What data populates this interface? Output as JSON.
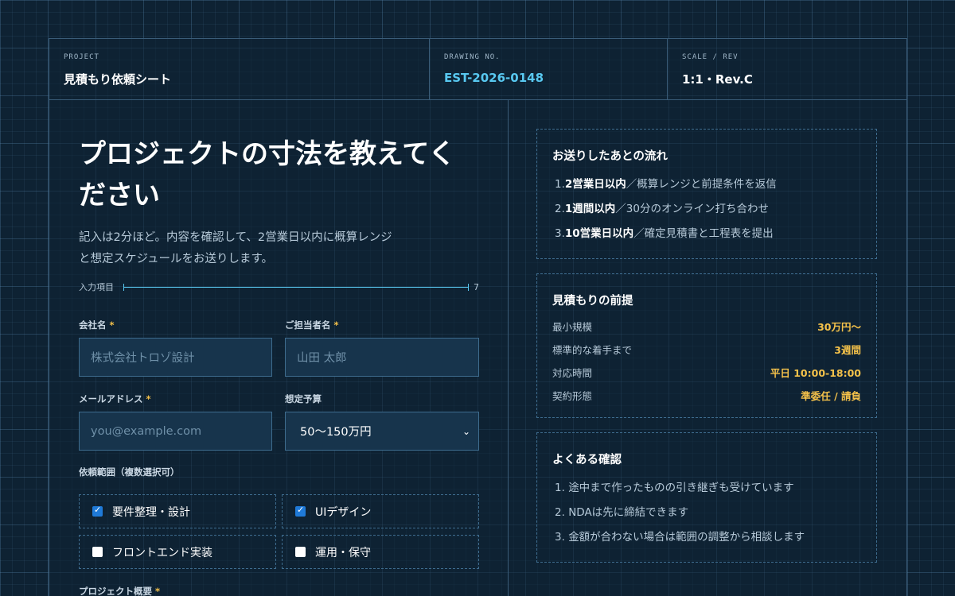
{
  "titleblock": {
    "project_label": "PROJECT",
    "project_value": "見積もり依頼シート",
    "drawing_label": "DRAWING NO.",
    "drawing_value": "EST-2026-0148",
    "scale_label": "SCALE / REV",
    "scale_value": "1:1・Rev.C"
  },
  "intro": {
    "headline": "プロジェクトの寸法を教えてください",
    "lead": "記入は2分ほど。内容を確認して、2営業日以内に概算レンジと想定スケジュールをお送りします。"
  },
  "counter": {
    "label": "入力項目",
    "count": "7"
  },
  "form": {
    "company": {
      "label": "会社名",
      "required": "*",
      "placeholder": "株式会社トロゾ設計"
    },
    "contact": {
      "label": "ご担当者名",
      "required": "*",
      "placeholder": "山田 太郎"
    },
    "email": {
      "label": "メールアドレス",
      "required": "*",
      "placeholder": "you@example.com"
    },
    "budget": {
      "label": "想定予算",
      "value": "50〜150万円"
    },
    "scope": {
      "label": "依頼範囲（複数選択可）",
      "options": [
        {
          "label": "要件整理・設計",
          "checked": true
        },
        {
          "label": "UIデザイン",
          "checked": true
        },
        {
          "label": "フロントエンド実装",
          "checked": false
        },
        {
          "label": "運用・保守",
          "checked": false
        }
      ]
    },
    "overview": {
      "label": "プロジェクト概要",
      "required": "*"
    }
  },
  "flow": {
    "title": "お送りしたあとの流れ",
    "steps": [
      {
        "num": "1.",
        "bold": "2営業日以内",
        "text": "／概算レンジと前提条件を返信"
      },
      {
        "num": "2.",
        "bold": "1週間以内",
        "text": "／30分のオンライン打ち合わせ"
      },
      {
        "num": "3.",
        "bold": "10営業日以内",
        "text": "／確定見積書と工程表を提出"
      }
    ]
  },
  "premise": {
    "title": "見積もりの前提",
    "rows": [
      {
        "key": "最小規模",
        "value": "30万円〜"
      },
      {
        "key": "標準的な着手まで",
        "value": "3週間"
      },
      {
        "key": "対応時間",
        "value": "平日 10:00-18:00"
      },
      {
        "key": "契約形態",
        "value": "準委任 / 請負"
      }
    ]
  },
  "faq": {
    "title": "よくある確認",
    "items": [
      {
        "num": "1.",
        "text": "途中まで作ったものの引き継ぎも受けています"
      },
      {
        "num": "2.",
        "text": "NDAは先に締結できます"
      },
      {
        "num": "3.",
        "text": "金額が合わない場合は範囲の調整から相談します"
      }
    ]
  },
  "colors": {
    "accent": "#58c8f0",
    "highlight": "#f5c24a",
    "background": "#0e2233"
  }
}
